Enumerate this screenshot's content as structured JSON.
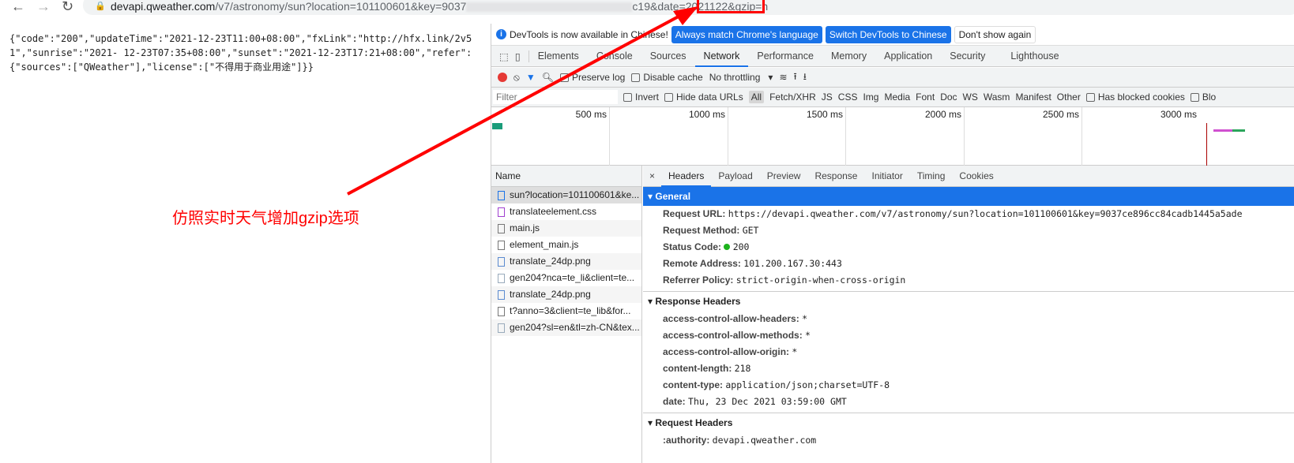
{
  "browser": {
    "url_host": "devapi.qweather.com",
    "url_path_start": "/v7/astronomy/sun?location=101100601&key=9037",
    "url_path_end": "c19&date=2021122",
    "url_highlight": "&gzip=n"
  },
  "page": {
    "json_text": "{\"code\":\"200\",\"updateTime\":\"2021-12-23T11:00+08:00\",\"fxLink\":\"http://hfx.link/2v51\",\"sunrise\":\"2021- 12-23T07:35+08:00\",\"sunset\":\"2021-12-23T17:21+08:00\",\"refer\":{\"sources\":[\"QWeather\"],\"license\":[\"不得用于商业用途\"]}}"
  },
  "annotation": {
    "text": "仿照实时天气增加gzip选项",
    "color": "#ff0000"
  },
  "devtools": {
    "infobar": {
      "message": "DevTools is now available in Chinese!",
      "btn1": "Always match Chrome's language",
      "btn2": "Switch DevTools to Chinese",
      "btn3": "Don't show again"
    },
    "tabs": [
      "Elements",
      "Console",
      "Sources",
      "Network",
      "Performance",
      "Memory",
      "Application",
      "Security",
      "Lighthouse"
    ],
    "toolbar": {
      "preserve_log": "Preserve log",
      "disable_cache": "Disable cache",
      "throttling": "No throttling"
    },
    "filterbar": {
      "placeholder": "Filter",
      "invert": "Invert",
      "hide_data_urls": "Hide data URLs",
      "types": [
        "All",
        "Fetch/XHR",
        "JS",
        "CSS",
        "Img",
        "Media",
        "Font",
        "Doc",
        "WS",
        "Wasm",
        "Manifest",
        "Other"
      ],
      "blocked_cookies": "Has blocked cookies",
      "blocked_requests": "Blo"
    },
    "timeline": [
      "500 ms",
      "1000 ms",
      "1500 ms",
      "2000 ms",
      "2500 ms",
      "3000 ms"
    ],
    "name_header": "Name",
    "requests": [
      "sun?location=101100601&ke...",
      "translateelement.css",
      "main.js",
      "element_main.js",
      "translate_24dp.png",
      "gen204?nca=te_li&client=te...",
      "translate_24dp.png",
      "t?anno=3&client=te_lib&for...",
      "gen204?sl=en&tl=zh-CN&tex..."
    ],
    "detail_tabs": [
      "Headers",
      "Payload",
      "Preview",
      "Response",
      "Initiator",
      "Timing",
      "Cookies"
    ],
    "general": {
      "title": "General",
      "items": [
        {
          "k": "Request URL:",
          "v": "https://devapi.qweather.com/v7/astronomy/sun?location=101100601&key=9037ce896cc84cadb1445a5ade"
        },
        {
          "k": "Request Method:",
          "v": "GET"
        },
        {
          "k": "Status Code:",
          "v": "200"
        },
        {
          "k": "Remote Address:",
          "v": "101.200.167.30:443"
        },
        {
          "k": "Referrer Policy:",
          "v": "strict-origin-when-cross-origin"
        }
      ]
    },
    "response_headers": {
      "title": "Response Headers",
      "items": [
        {
          "k": "access-control-allow-headers:",
          "v": "*"
        },
        {
          "k": "access-control-allow-methods:",
          "v": "*"
        },
        {
          "k": "access-control-allow-origin:",
          "v": "*"
        },
        {
          "k": "content-length:",
          "v": "218"
        },
        {
          "k": "content-type:",
          "v": "application/json;charset=UTF-8"
        },
        {
          "k": "date:",
          "v": "Thu, 23 Dec 2021 03:59:00 GMT"
        }
      ]
    },
    "request_headers": {
      "title": "Request Headers",
      "items": [
        {
          "k": ":authority:",
          "v": "devapi.qweather.com"
        }
      ]
    }
  }
}
